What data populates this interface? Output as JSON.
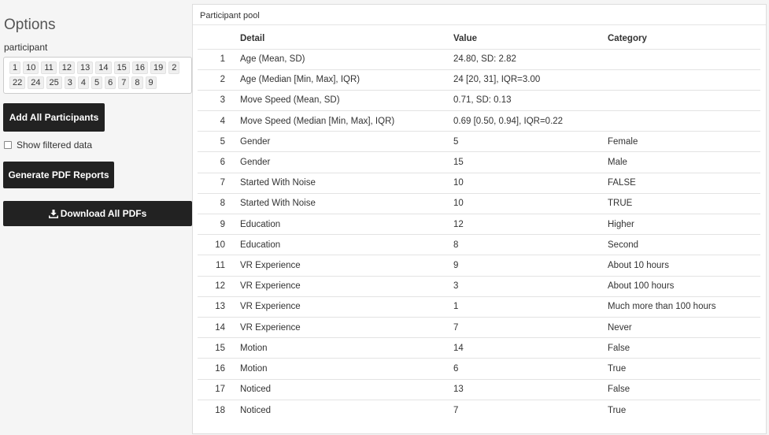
{
  "sidebar": {
    "title": "Options",
    "participant_label": "participant",
    "participants": [
      "1",
      "10",
      "11",
      "12",
      "13",
      "14",
      "15",
      "16",
      "19",
      "2",
      "22",
      "24",
      "25",
      "3",
      "4",
      "5",
      "6",
      "7",
      "8",
      "9"
    ],
    "add_all_label": "Add All Participants",
    "show_filtered_label": "Show filtered data",
    "show_filtered_checked": false,
    "generate_label": "Generate PDF Reports",
    "download_label": "Download All PDFs"
  },
  "panel": {
    "title": "Participant pool",
    "columns": [
      "",
      "Detail",
      "Value",
      "Category"
    ],
    "rows": [
      [
        "1",
        "Age (Mean, SD)",
        "24.80, SD: 2.82",
        ""
      ],
      [
        "2",
        "Age (Median [Min, Max], IQR)",
        "24 [20, 31], IQR=3.00",
        ""
      ],
      [
        "3",
        "Move Speed (Mean, SD)",
        "0.71, SD: 0.13",
        ""
      ],
      [
        "4",
        "Move Speed (Median [Min, Max], IQR)",
        "0.69 [0.50, 0.94], IQR=0.22",
        ""
      ],
      [
        "5",
        "Gender",
        "5",
        "Female"
      ],
      [
        "6",
        "Gender",
        "15",
        "Male"
      ],
      [
        "7",
        "Started With Noise",
        "10",
        "FALSE"
      ],
      [
        "8",
        "Started With Noise",
        "10",
        "TRUE"
      ],
      [
        "9",
        "Education",
        "12",
        "Higher"
      ],
      [
        "10",
        "Education",
        "8",
        "Second"
      ],
      [
        "11",
        "VR Experience",
        "9",
        "About 10 hours"
      ],
      [
        "12",
        "VR Experience",
        "3",
        "About 100 hours"
      ],
      [
        "13",
        "VR Experience",
        "1",
        "Much more than 100 hours"
      ],
      [
        "14",
        "VR Experience",
        "7",
        "Never"
      ],
      [
        "15",
        "Motion",
        "14",
        "False"
      ],
      [
        "16",
        "Motion",
        "6",
        "True"
      ],
      [
        "17",
        "Noticed",
        "13",
        "False"
      ],
      [
        "18",
        "Noticed",
        "7",
        "True"
      ]
    ]
  },
  "icons": {
    "download": "download-icon"
  },
  "colors": {
    "button_bg": "#222222",
    "button_text": "#ffffff",
    "page_bg": "#f5f5f5"
  }
}
